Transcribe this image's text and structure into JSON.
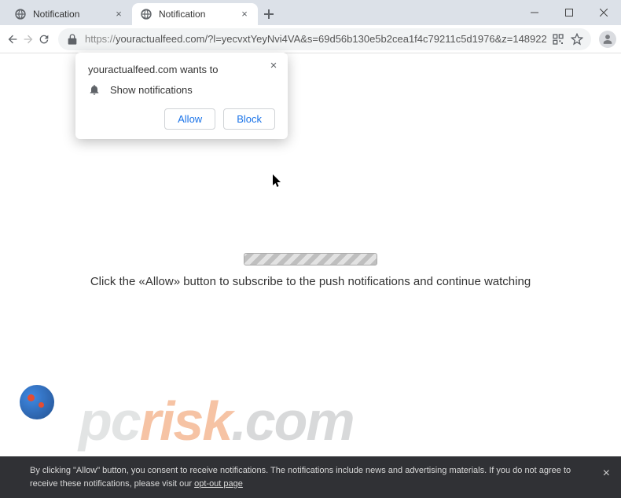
{
  "tabs": [
    {
      "title": "Notification",
      "active": false
    },
    {
      "title": "Notification",
      "active": true
    }
  ],
  "toolbar": {
    "url_scheme": "https://",
    "url_rest": "youractualfeed.com/?l=yecvxtYeyNvi4VA&s=69d56b130e5b2cea1f4c79211c5d1976&z=148922"
  },
  "dialog": {
    "origin": "youractualfeed.com wants to",
    "permission": "Show notifications",
    "allow": "Allow",
    "block": "Block"
  },
  "page": {
    "instruction": "Click the «Allow» button to subscribe to the push notifications and continue watching"
  },
  "watermark": {
    "p1": "pc",
    "p2": "risk",
    "p3": ".com"
  },
  "consent": {
    "text": "By clicking \"Allow\" button, you consent to receive notifications. The notifications include news and advertising materials. If you do not agree to receive these notifications, please visit our ",
    "opt": "opt-out page"
  }
}
